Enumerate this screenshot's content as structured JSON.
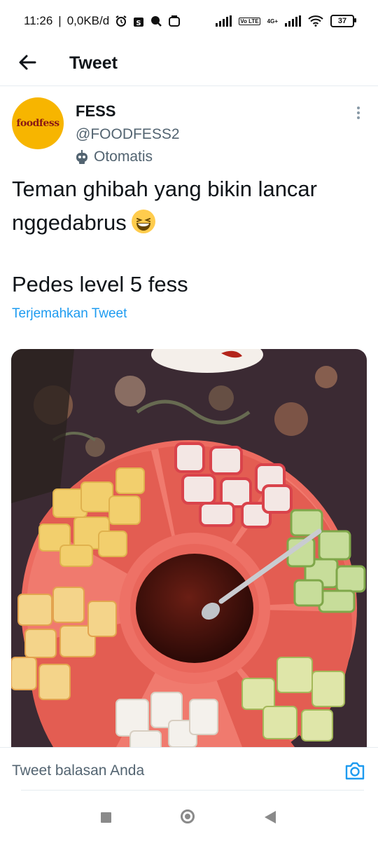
{
  "status_bar": {
    "time": "11:26",
    "network_speed": "0,0KB/d",
    "network_label": "4G+",
    "volte_label": "Vo LTE",
    "battery": "37"
  },
  "header": {
    "title": "Tweet"
  },
  "tweet": {
    "author_name": "FESS",
    "avatar_text": "foodfess",
    "handle": "@FOODFESS2",
    "automated_label": "Otomatis",
    "text_line1": "Teman ghibah yang bikin lancar",
    "text_line2": "nggedabrus",
    "text_para2": "Pedes level 5 fess",
    "translate_link": "Terjemahkan Tweet"
  },
  "reply": {
    "placeholder": "Tweet balasan Anda"
  },
  "colors": {
    "accent": "#1d9bf0",
    "secondary_text": "#536471",
    "avatar_bg": "#f7b500"
  }
}
